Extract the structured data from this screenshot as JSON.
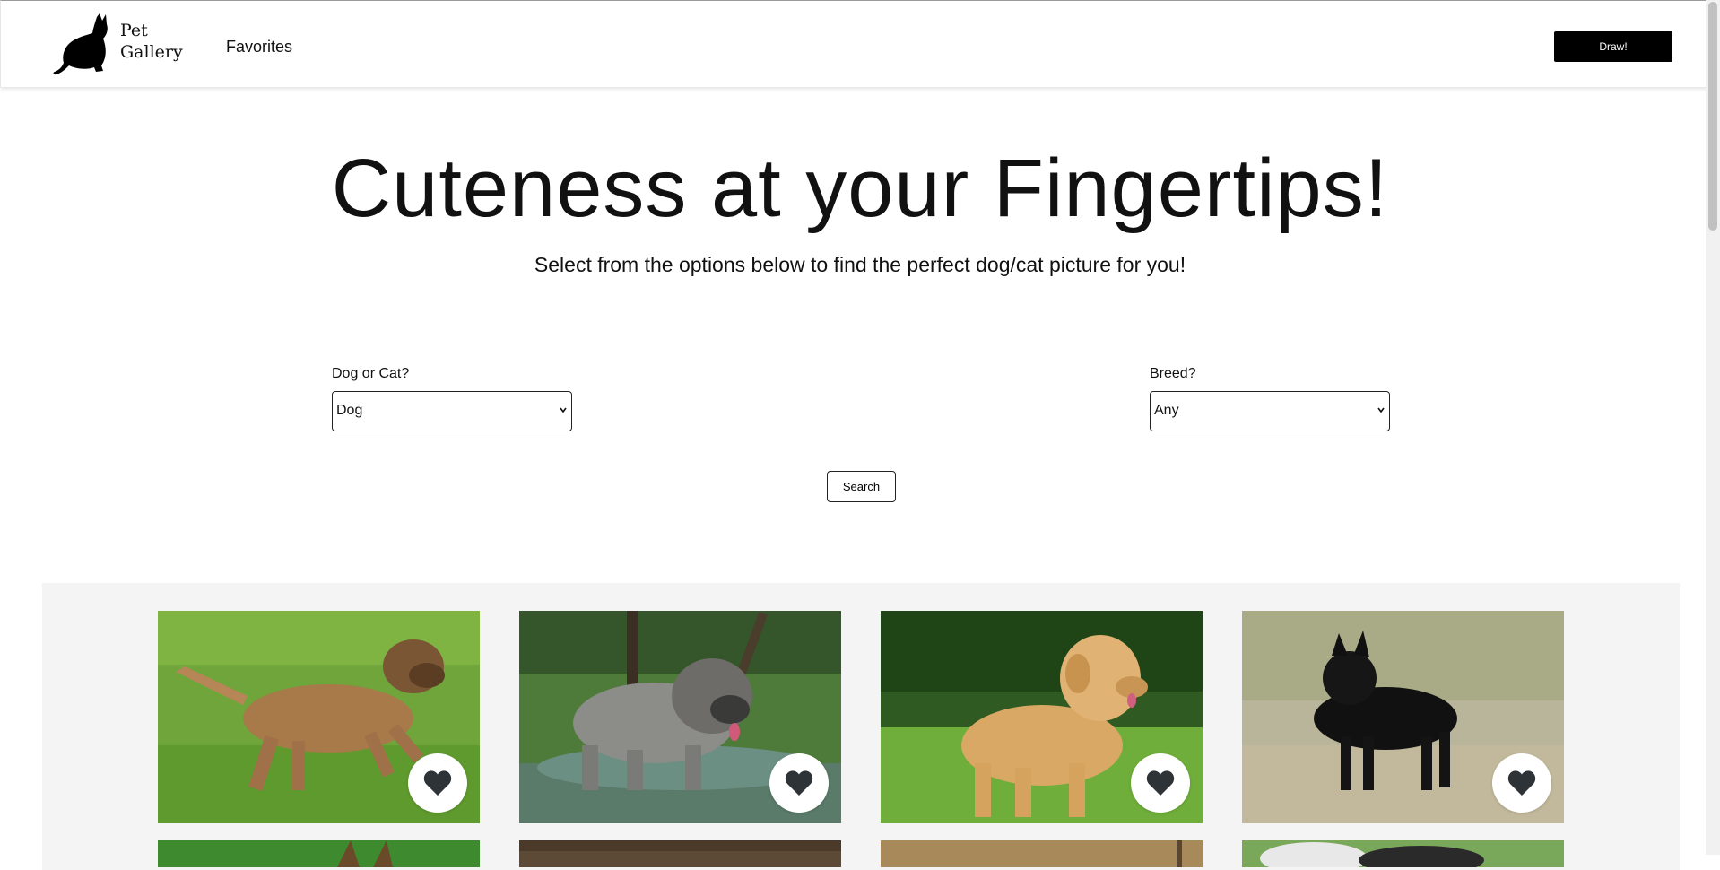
{
  "header": {
    "brand_line1": "Pet",
    "brand_line2": "Gallery",
    "logo_icon": "cat-silhouette-icon",
    "nav_favorites": "Favorites",
    "draw_button": "Draw!"
  },
  "hero": {
    "title": "Cuteness at your Fingertips!",
    "subtitle": "Select from the options below to find the perfect dog/cat picture for you!"
  },
  "filters": {
    "animal_label": "Dog or Cat?",
    "animal_value": "Dog",
    "breed_label": "Breed?",
    "breed_value": "Any",
    "search_button": "Search"
  },
  "gallery": {
    "cards": [
      {
        "subject": "border terrier running on grass",
        "favorite_icon": "heart-icon"
      },
      {
        "subject": "grey fluffy dog in marsh water",
        "favorite_icon": "heart-icon"
      },
      {
        "subject": "golden retriever in grass",
        "favorite_icon": "heart-icon"
      },
      {
        "subject": "black schipperke in dry grass",
        "favorite_icon": "heart-icon"
      }
    ]
  },
  "colors": {
    "accent": "#000000",
    "gallery_background": "#f4f4f4",
    "heart": "#2e3338"
  }
}
